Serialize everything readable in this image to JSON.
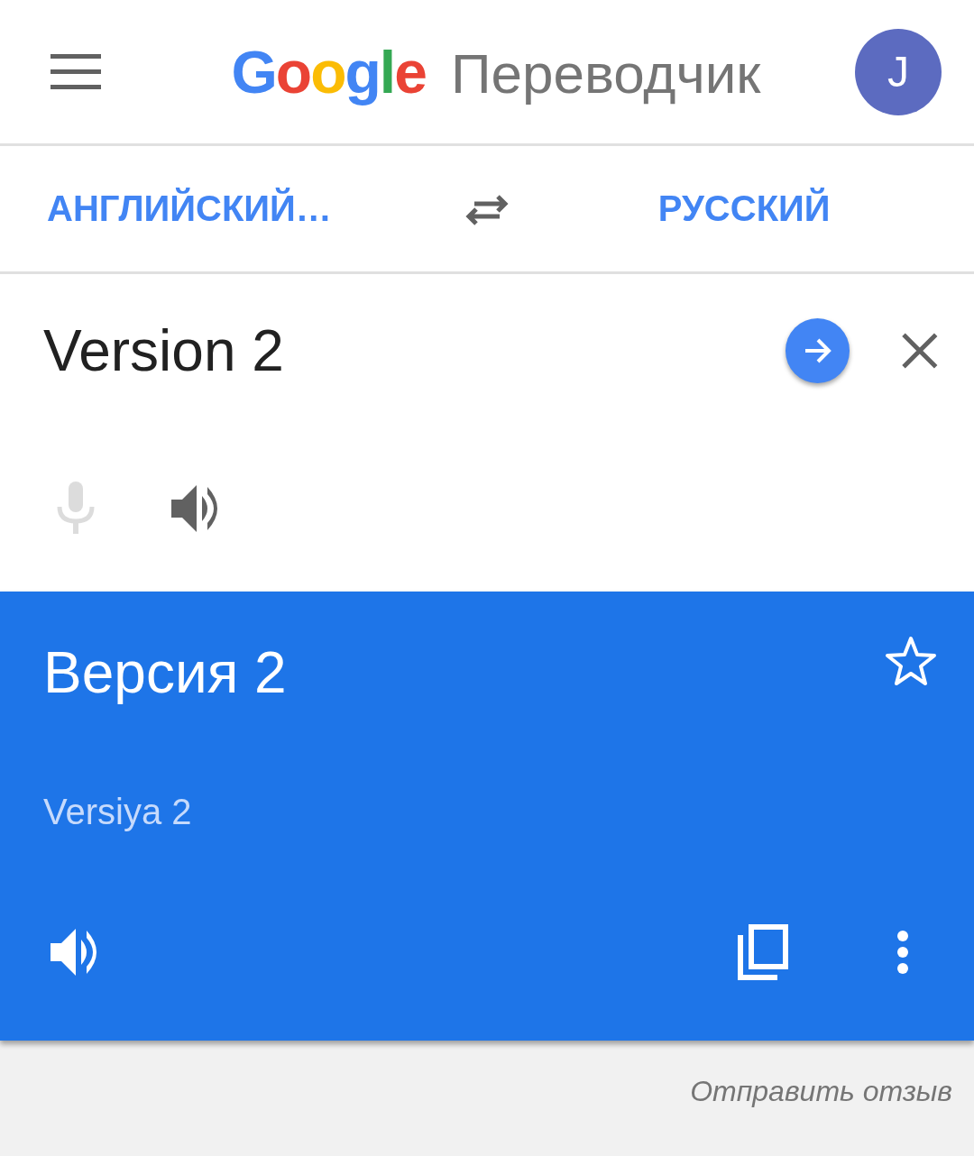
{
  "header": {
    "logo": "Google",
    "title": "Переводчик",
    "avatar": "J"
  },
  "languages": {
    "source": "АНГЛИЙСКИЙ…",
    "target": "РУССКИЙ"
  },
  "input": {
    "value": "Version 2",
    "mic_disabled": true
  },
  "result": {
    "translation": "Версия 2",
    "transliteration": "Versiya 2",
    "starred": false
  },
  "feedback": "Отправить отзыв"
}
